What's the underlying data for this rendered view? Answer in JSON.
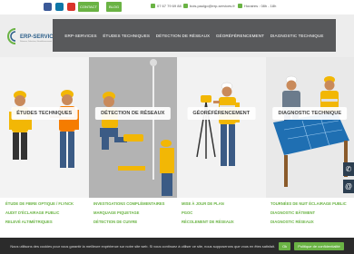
{
  "topbar": {
    "contact_label": "CONTACT",
    "blog_label": "BLOG",
    "phone": "07 67 79 69 88",
    "email": "bois.paulgo@erp-services.fr",
    "hours": "Horaires : 08h - 18h",
    "social_icons": [
      "facebook-icon",
      "linkedin-icon",
      "youtube-icon"
    ],
    "accent": "#6ab344"
  },
  "logo": {
    "name": "ERP-SERVICES",
    "tagline": "Réseaux, Détection, Géoréférencement"
  },
  "nav": {
    "items": [
      "ERP-SERVICES",
      "ÉTUDES TECHNIQUES",
      "DÉTECTION DE RÉSEAUX",
      "GÉORÉFÉRENCEMENT",
      "DIAGNOSTIC TECHNIQUE"
    ]
  },
  "panels": [
    {
      "label": "ÉTUDES TECHNIQUES"
    },
    {
      "label": "DÉTECTION DE RÉSEAUX"
    },
    {
      "label": "GÉORÉFÉRENCEMENT"
    },
    {
      "label": "DIAGNOSTIC TECHNIQUE"
    }
  ],
  "services": {
    "col1": [
      "ÉTUDE DE FIBRE OPTIQUE / FLYNCK",
      "AUDIT D'ÉCLAIRAGE PUBLIC",
      "RELEVÉ ALTIMÉTRIQUES"
    ],
    "col2": [
      "INVESTIGATIONS COMPLÉMENTAIRES",
      "MARQUAGE PIQUETAGE",
      "DÉTECTION DE CUIVRE"
    ],
    "col3": [
      "MISE À JOUR DE PLAN",
      "PGOC",
      "RÉCOLEMENT DE RÉSEAUX"
    ],
    "col4": [
      "TOURNÉES DE NUIT ÉCLAIRAGE PUBLIC",
      "DIAGNOSTIC BÂTIMENT",
      "DIAGNOSTIC RÉSEAUX"
    ]
  },
  "side": {
    "phone_icon": "phone-icon",
    "email_icon": "at-icon"
  },
  "cookie": {
    "text": "Nous utilisons des cookies pour vous garantir la meilleure expérience sur notre site web. Si vous continuez à utiliser ce site, nous supposerons que vous en êtes satisfait.",
    "ok_label": "Ok",
    "policy_label": "Politique de confidentialité"
  }
}
